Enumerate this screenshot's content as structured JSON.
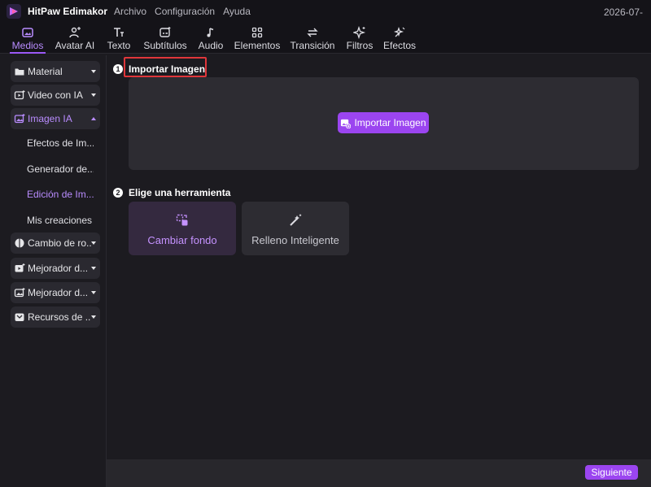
{
  "titlebar": {
    "app_name": "HitPaw Edimakor",
    "menu": [
      "Archivo",
      "Configuración",
      "Ayuda"
    ],
    "date": "2026-07-"
  },
  "toolbar": {
    "tabs": [
      {
        "label": "Medios",
        "icon": "media-icon",
        "active": true
      },
      {
        "label": "Avatar AI",
        "icon": "avatar-icon"
      },
      {
        "label": "Texto",
        "icon": "text-icon"
      },
      {
        "label": "Subtítulos",
        "icon": "subtitles-icon"
      },
      {
        "label": "Audio",
        "icon": "music-note-icon"
      },
      {
        "label": "Elementos",
        "icon": "elements-icon"
      },
      {
        "label": "Transición",
        "icon": "transition-icon"
      },
      {
        "label": "Filtros",
        "icon": "sparkle-icon"
      },
      {
        "label": "Efectos",
        "icon": "effects-icon"
      }
    ]
  },
  "sidebar": {
    "items": [
      {
        "label": "Material",
        "icon": "folder-icon"
      },
      {
        "label": "Video con IA",
        "icon": "video-ai-icon"
      },
      {
        "label": "Imagen IA",
        "icon": "image-ai-icon",
        "open": true
      },
      {
        "label": "Cambio de ro...",
        "icon": "face-swap-icon"
      },
      {
        "label": "Mejorador d...",
        "icon": "video-enhancer-icon"
      },
      {
        "label": "Mejorador d...",
        "icon": "image-enhancer-icon"
      },
      {
        "label": "Recursos de ...",
        "icon": "resources-icon"
      }
    ],
    "subitems": [
      {
        "label": "Efectos de Im..."
      },
      {
        "label": "Generador de..."
      },
      {
        "label": "Edición de Im...",
        "active": true
      },
      {
        "label": "Mis creaciones"
      }
    ]
  },
  "main": {
    "step1": {
      "num": "1",
      "title": "Importar Imagen"
    },
    "import_button": "Importar Imagen",
    "step2": {
      "num": "2",
      "title": "Elige una herramienta"
    },
    "tools": [
      {
        "label": "Cambiar fondo",
        "icon": "change-background-icon",
        "selected": true
      },
      {
        "label": "Relleno Inteligente",
        "icon": "magic-wand-icon"
      }
    ]
  },
  "footer": {
    "next_label": "Siguiente"
  },
  "colors": {
    "accent": "#9b45f0",
    "accent_text": "#b98cff",
    "highlight": "#e0363a"
  }
}
